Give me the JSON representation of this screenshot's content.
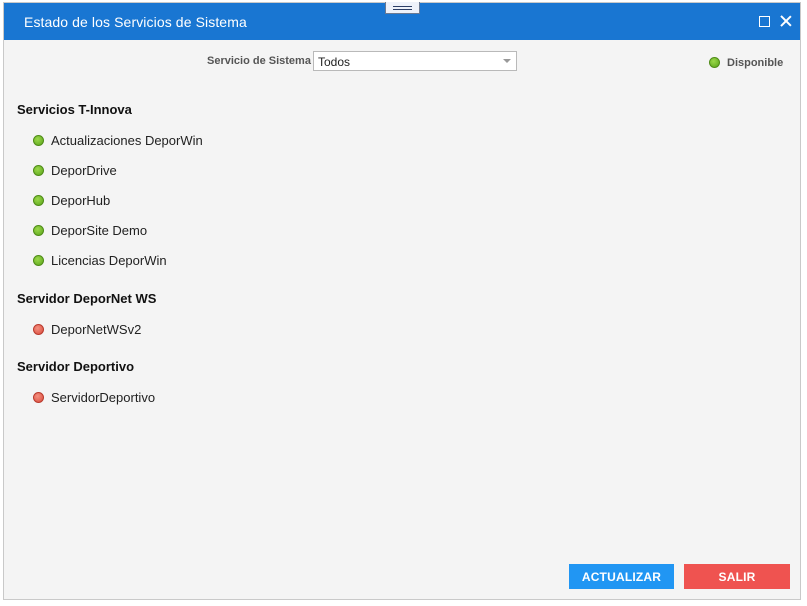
{
  "window": {
    "title": "Estado de los Servicios de Sistema"
  },
  "filter": {
    "label": "Servicio de Sistema",
    "selected": "Todos"
  },
  "legend": {
    "label": "Disponible",
    "color": "#5aa41a"
  },
  "groups": [
    {
      "title": "Servicios T-Innova",
      "services": [
        {
          "name": "Actualizaciones DeporWin",
          "status": "green"
        },
        {
          "name": "DeporDrive",
          "status": "green"
        },
        {
          "name": "DeporHub",
          "status": "green"
        },
        {
          "name": "DeporSite Demo",
          "status": "green"
        },
        {
          "name": "Licencias DeporWin",
          "status": "green"
        }
      ]
    },
    {
      "title": "Servidor DeporNet WS",
      "services": [
        {
          "name": "DeporNetWSv2",
          "status": "red"
        }
      ]
    },
    {
      "title": "Servidor Deportivo",
      "services": [
        {
          "name": "ServidorDeportivo",
          "status": "red"
        }
      ]
    }
  ],
  "buttons": {
    "refresh": "ACTUALIZAR",
    "exit": "SALIR"
  },
  "colors": {
    "titlebar": "#1976d2",
    "refresh": "#2196f3",
    "exit": "#ef5350",
    "available": "#5aa41a",
    "unavailable": "#d94a3c"
  }
}
